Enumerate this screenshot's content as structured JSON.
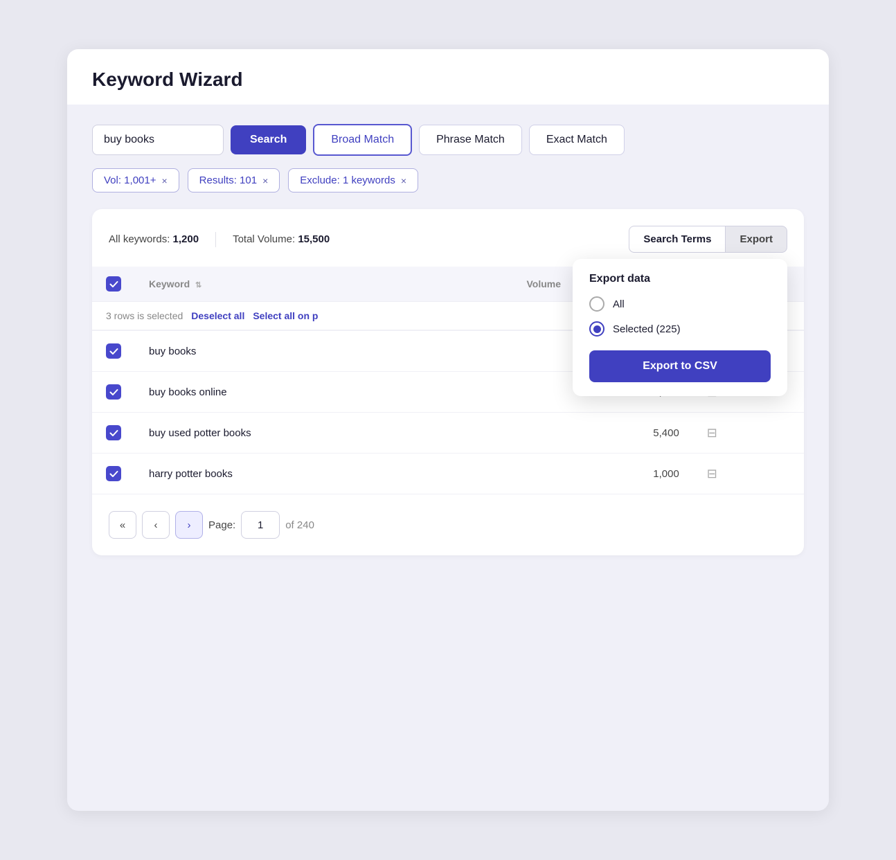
{
  "header": {
    "title": "Keyword Wizard"
  },
  "search": {
    "input_value": "buy books",
    "input_placeholder": "buy books",
    "search_button_label": "Search",
    "match_options": [
      {
        "id": "broad",
        "label": "Broad Match",
        "active": true
      },
      {
        "id": "phrase",
        "label": "Phrase Match",
        "active": false
      },
      {
        "id": "exact",
        "label": "Exact Match",
        "active": false
      }
    ]
  },
  "filters": [
    {
      "id": "vol",
      "label": "Vol: 1,001+",
      "close": "×"
    },
    {
      "id": "results",
      "label": "Results: 101",
      "close": "×"
    },
    {
      "id": "exclude",
      "label": "Exclude: 1 keywords",
      "close": "×"
    }
  ],
  "summary": {
    "all_keywords_label": "All keywords:",
    "all_keywords_value": "1,200",
    "total_volume_label": "Total Volume:",
    "total_volume_value": "15,500",
    "search_terms_btn": "Search Terms",
    "export_btn": "Export"
  },
  "export_dropdown": {
    "title": "Export data",
    "options": [
      {
        "id": "all",
        "label": "All",
        "selected": false
      },
      {
        "id": "selected",
        "label": "Selected (225)",
        "selected": true
      }
    ],
    "export_csv_label": "Export to CSV"
  },
  "table": {
    "columns": [
      {
        "id": "checkbox",
        "label": ""
      },
      {
        "id": "keyword",
        "label": "Keyword"
      },
      {
        "id": "volume",
        "label": "Volume"
      },
      {
        "id": "actions",
        "label": ""
      }
    ],
    "selection_info": "3 rows is selected",
    "deselect_all": "Deselect all",
    "select_all_on": "Select all on p",
    "rows": [
      {
        "id": 1,
        "keyword": "buy books",
        "volume": "",
        "checked": true
      },
      {
        "id": 2,
        "keyword": "buy books online",
        "volume": "5,400",
        "checked": true
      },
      {
        "id": 3,
        "keyword": "buy used potter books",
        "volume": "5,400",
        "checked": true
      },
      {
        "id": 4,
        "keyword": "harry potter books",
        "volume": "1,000",
        "checked": true
      }
    ]
  },
  "pagination": {
    "first_btn": "«",
    "prev_btn": "‹",
    "next_btn": "›",
    "page_label": "Page:",
    "current_page": "1",
    "of_label": "of 240"
  }
}
